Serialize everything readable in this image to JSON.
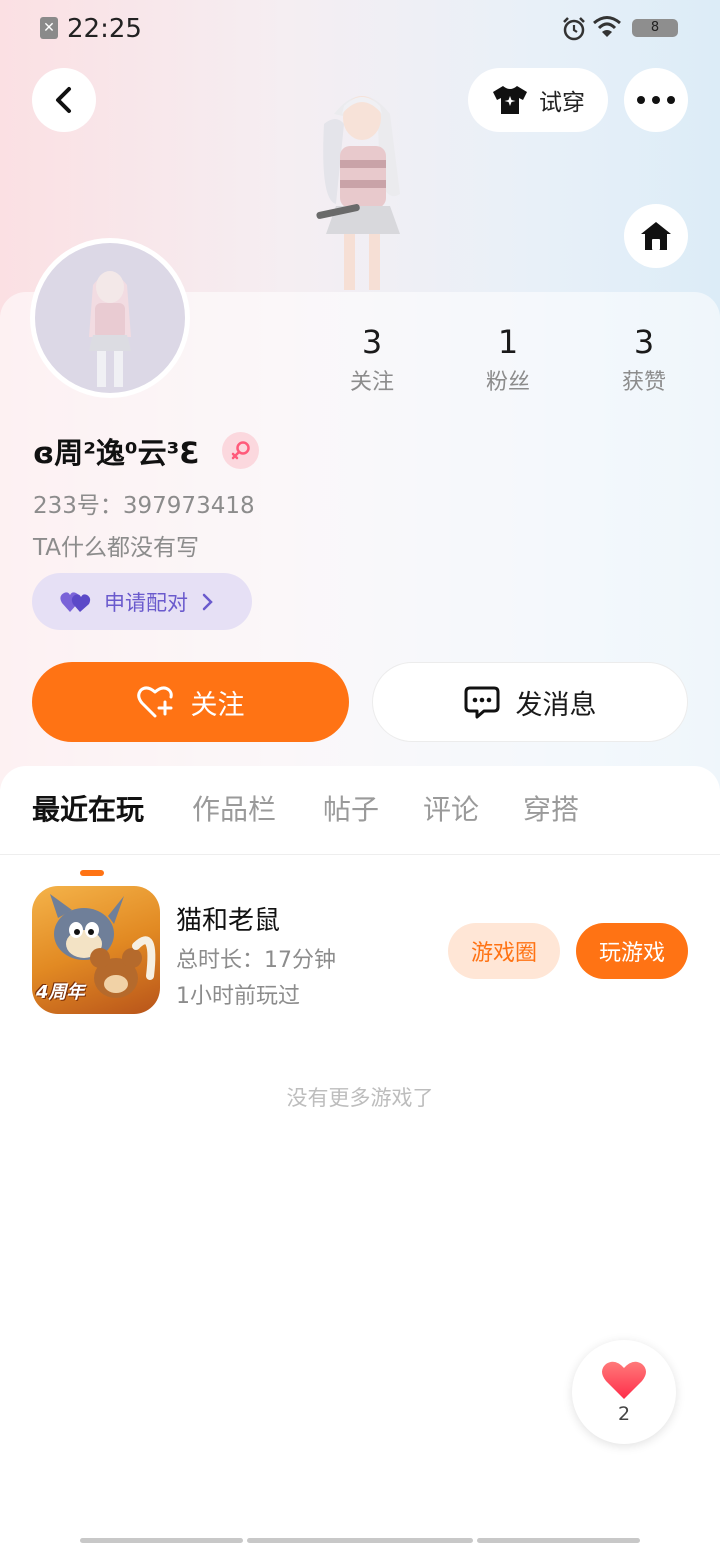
{
  "status_bar": {
    "time": "22:25",
    "battery": "8"
  },
  "header": {
    "try_on_label": "试穿"
  },
  "stats": [
    {
      "value": "3",
      "label": "关注"
    },
    {
      "value": "1",
      "label": "粉丝"
    },
    {
      "value": "3",
      "label": "获赞"
    }
  ],
  "profile": {
    "username": "ɞ周²逸⁰云³Ɛ",
    "uid": "233号：397973418",
    "bio": "TA什么都没有写",
    "pair_label": "申请配对"
  },
  "actions": {
    "follow_label": "关注",
    "message_label": "发消息"
  },
  "tabs": [
    "最近在玩",
    "作品栏",
    "帖子",
    "评论",
    "穿搭"
  ],
  "games": [
    {
      "name": "猫和老鼠",
      "duration": "总时长：17分钟",
      "last_played": "1小时前玩过",
      "icon_badge": "4周年",
      "circle_label": "游戏圈",
      "play_label": "玩游戏"
    }
  ],
  "no_more_text": "没有更多游戏了",
  "likes": {
    "count": "2"
  },
  "colors": {
    "accent": "#ff7314",
    "pair": "#6a5acd",
    "heart": "#ff4d5e"
  }
}
